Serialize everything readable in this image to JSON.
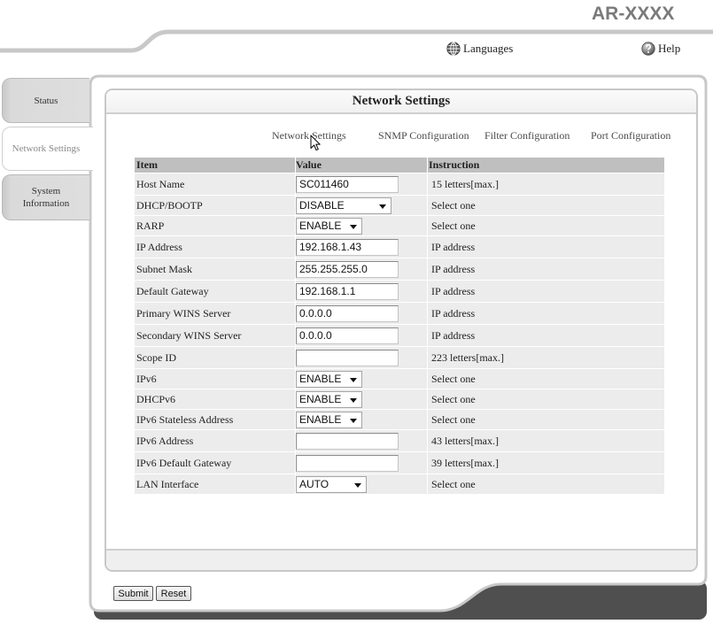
{
  "header": {
    "model": "AR-XXXX",
    "languages": {
      "label": "Languages",
      "icon": "globe-icon"
    },
    "help": {
      "label": "Help",
      "icon": "help-icon"
    }
  },
  "side_tabs": [
    {
      "label": "Status",
      "selected": false
    },
    {
      "label": "Network Settings",
      "selected": true
    },
    {
      "label": "System Information",
      "selected": false
    }
  ],
  "page_title": "Network Settings",
  "sub_nav": [
    {
      "label": "Network Settings"
    },
    {
      "label": "SNMP Configuration"
    },
    {
      "label": "Filter Configuration"
    },
    {
      "label": "Port Configuration"
    }
  ],
  "table": {
    "headers": {
      "item": "Item",
      "value": "Value",
      "instruction": "Instruction"
    },
    "rows": [
      {
        "item": "Host Name",
        "value": "SC011460",
        "instruction": "15 letters[max.]"
      },
      {
        "item": "DHCP/BOOTP",
        "value": "DISABLE",
        "instruction": "Select one"
      },
      {
        "item": "RARP",
        "value": "ENABLE",
        "instruction": "Select one"
      },
      {
        "item": "IP Address",
        "value": "192.168.1.43",
        "instruction": "IP address"
      },
      {
        "item": "Subnet Mask",
        "value": "255.255.255.0",
        "instruction": "IP address"
      },
      {
        "item": "Default Gateway",
        "value": "192.168.1.1",
        "instruction": "IP address"
      },
      {
        "item": "Primary WINS Server",
        "value": "0.0.0.0",
        "instruction": "IP address"
      },
      {
        "item": "Secondary WINS Server",
        "value": "0.0.0.0",
        "instruction": "IP address"
      },
      {
        "item": "Scope ID",
        "value": "",
        "instruction": "223 letters[max.]"
      },
      {
        "item": "IPv6",
        "value": "ENABLE",
        "instruction": "Select one"
      },
      {
        "item": "DHCPv6",
        "value": "ENABLE",
        "instruction": "Select one"
      },
      {
        "item": "IPv6 Stateless Address",
        "value": "ENABLE",
        "instruction": "Select one"
      },
      {
        "item": "IPv6 Address",
        "value": "",
        "instruction": "43 letters[max.]"
      },
      {
        "item": "IPv6 Default Gateway",
        "value": "",
        "instruction": "39 letters[max.]"
      },
      {
        "item": "LAN Interface",
        "value": "AUTO",
        "instruction": "Select one"
      }
    ]
  },
  "buttons": {
    "submit": "Submit",
    "reset": "Reset"
  },
  "colors": {
    "model_text": "#7a7a7a",
    "frame": "#c8c8c8",
    "shadow": "#4f4f4f",
    "table_header": "#bfbfbf",
    "table_row": "#ececec",
    "tab_inactive": "#dedede"
  }
}
